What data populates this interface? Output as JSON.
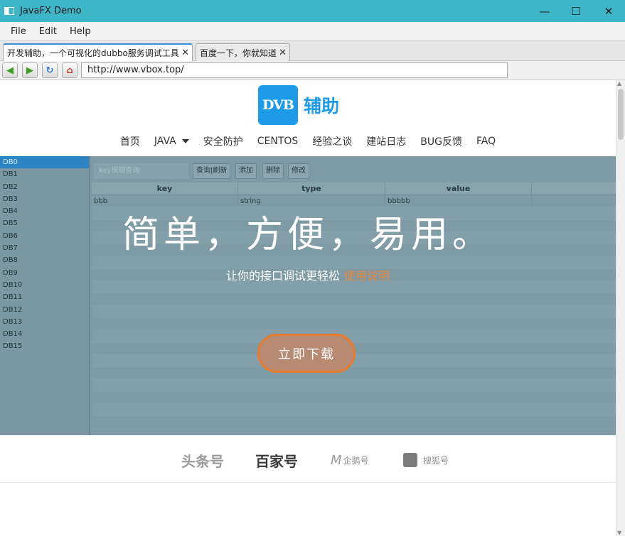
{
  "window": {
    "title": "JavaFX Demo",
    "minimize": "—",
    "maximize": "☐",
    "close": "✕"
  },
  "menu": [
    "File",
    "Edit",
    "Help"
  ],
  "tabs": [
    {
      "label": "开发辅助，一个可视化的dubbo服务调试工具",
      "close": "✕",
      "active": true
    },
    {
      "label": "百度一下，你就知道",
      "close": "✕",
      "active": false
    }
  ],
  "nav": {
    "url": "http://www.vbox.top/",
    "back_icon": "back-arrow-icon",
    "forward_icon": "forward-arrow-icon",
    "reload_icon": "reload-icon",
    "home_icon": "home-icon"
  },
  "site": {
    "logo_mark": "DVB",
    "logo_text": "辅助",
    "nav_items": [
      "首页",
      "JAVA",
      "安全防护",
      "CENTOS",
      "经验之谈",
      "建站日志",
      "BUG反馈",
      "FAQ"
    ],
    "hero_title": "简单，方便，易用。",
    "hero_subtitle": "让你的接口调试更轻松",
    "hero_link": "使用说明",
    "download_label": "立即下载",
    "partners": [
      "头条号",
      "百家号",
      "企鹅号",
      "搜狐号"
    ]
  },
  "background_app": {
    "databases": [
      "DB0",
      "DB1",
      "DB2",
      "DB3",
      "DB4",
      "DB5",
      "DB6",
      "DB7",
      "DB8",
      "DB9",
      "DB10",
      "DB11",
      "DB12",
      "DB13",
      "DB14",
      "DB15"
    ],
    "selected_db": "DB0",
    "search_placeholder": "key模糊查询",
    "buttons": [
      "查询|刷新",
      "添加",
      "删除",
      "修改"
    ],
    "columns": [
      "key",
      "type",
      "value"
    ],
    "rows": [
      [
        "bbb",
        "string",
        "bbbbb"
      ]
    ]
  },
  "colors": {
    "titlebar": "#3fb6c7",
    "accent_link": "#e8893f",
    "logo_blue": "#1e9be8",
    "hero_overlay": "#7e9aa5"
  }
}
